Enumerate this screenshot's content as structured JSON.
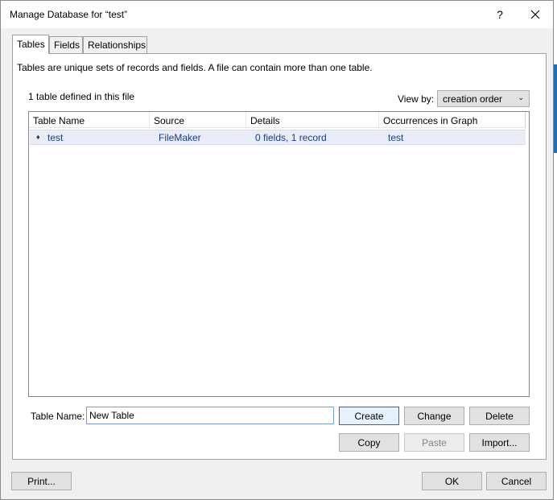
{
  "window": {
    "title": "Manage Database for “test”",
    "help_label": "?"
  },
  "tabs": [
    {
      "label": "Tables",
      "active": true
    },
    {
      "label": "Fields",
      "active": false
    },
    {
      "label": "Relationships",
      "active": false
    }
  ],
  "tables_tab": {
    "description": "Tables are unique sets of records and fields. A file can contain more than one table.",
    "count_text": "1 table defined in this file",
    "view_by_label": "View by:",
    "view_by_value": "creation order",
    "columns": [
      "Table Name",
      "Source",
      "Details",
      "Occurrences in Graph"
    ],
    "rows": [
      {
        "table_name": "test",
        "source": "FileMaker",
        "details": "0 fields, 1 record",
        "occurrences": "test"
      }
    ],
    "table_name_label": "Table Name:",
    "table_name_value": "New Table",
    "buttons": {
      "create": "Create",
      "change": "Change",
      "delete": "Delete",
      "copy": "Copy",
      "paste": "Paste",
      "import": "Import..."
    }
  },
  "footer": {
    "print": "Print...",
    "ok": "OK",
    "cancel": "Cancel"
  },
  "colors": {
    "selected_row_bg": "#e8ecf6",
    "selected_row_text": "#1a3a8c",
    "default_button_border": "#0078d7"
  }
}
